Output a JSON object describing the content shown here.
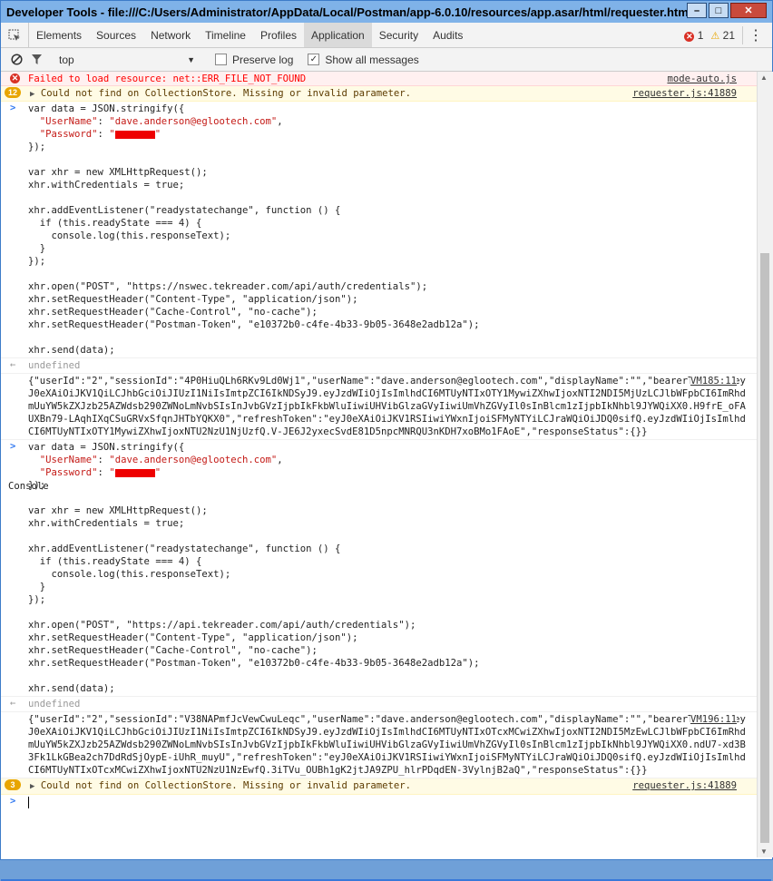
{
  "window": {
    "title": "Developer Tools - file:///C:/Users/Administrator/AppData/Local/Postman/app-6.0.10/resources/app.asar/html/requester.html"
  },
  "tabs": [
    "Elements",
    "Console",
    "Sources",
    "Network",
    "Timeline",
    "Profiles",
    "Application",
    "Security",
    "Audits"
  ],
  "counts": {
    "errors": "1",
    "warnings": "21"
  },
  "toolbar": {
    "context": "top",
    "preserve_log": "Preserve log",
    "show_all": "Show all messages"
  },
  "messages": {
    "m1": {
      "text": "Failed to load resource: net::ERR_FILE_NOT_FOUND",
      "source": "mode-auto.js"
    },
    "m2": {
      "count": "12",
      "text": "Could not find on CollectionStore. Missing or invalid parameter.",
      "source": "requester.js:41889"
    },
    "undefined1": "undefined",
    "log1": {
      "source": "VM185:11",
      "text": "{\"userId\":\"2\",\"sessionId\":\"4P0HiuQLh6RKv9Ld0Wj1\",\"userName\":\"dave.anderson@eglootech.com\",\"displayName\":\"\",\"bearerToken\":\"eyJ0eXAiOiJKV1QiLCJhbGciOiJIUzI1NiIsImtpZCI6IkNDSyJ9.eyJzdWIiOjIsImlhdCI6MTUyNTIxOTY1MywiZXhwIjoxNTI2NDI5MjUzLCJlbWFpbCI6ImRhdmUuYW5kZXJzb25AZWdsb290ZWNoLmNvbSIsInJvbGVzIjpbIkFkbWluIiwiUHVibGlzaGVyIiwiUmVhZGVyIl0sInBlcm1zIjpbIkNhbl9JYWQiXX0.H9frE_oFAUXBn79-LAqhIXqCSuGRVxSfqnJHTbYQKX0\",\"refreshToken\":\"eyJ0eXAiOiJKV1RSIiwiYWxnIjoiSFMyNTYiLCJraWQiOiJDQ0sifQ.eyJzdWIiOjIsImlhdCI6MTUyNTIxOTY1MywiZXhwIjoxNTU2NzU1NjUzfQ.V-JE6J2yxecSvdE81D5npcMNRQU3nKDH7xoBMo1FAoE\",\"responseStatus\":{}}"
    },
    "undefined2": "undefined",
    "log2": {
      "source": "VM196:11",
      "text": "{\"userId\":\"2\",\"sessionId\":\"V38NAPmfJcVewCwuLeqc\",\"userName\":\"dave.anderson@eglootech.com\",\"displayName\":\"\",\"bearerToken\":\"eyJ0eXAiOiJKV1QiLCJhbGciOiJIUzI1NiIsImtpZCI6IkNDSyJ9.eyJzdWIiOjIsImlhdCI6MTUyNTIxOTcxMCwiZXhwIjoxNTI2NDI5MzEwLCJlbWFpbCI6ImRhdmUuYW5kZXJzb25AZWdsb290ZWNoLmNvbSIsInJvbGVzIjpbIkFkbWluIiwiUHVibGlzaGVyIiwiUmVhZGVyIl0sInBlcm1zIjpbIkNhbl9JYWQiXX0.ndU7-xd3B3Fk1LkGBea2ch7DdRdSjOypE-iUhR_muyU\",\"refreshToken\":\"eyJ0eXAiOiJKV1RSIiwiYWxnIjoiSFMyNTYiLCJraWQiOiJDQ0sifQ.eyJzdWIiOjIsImlhdCI6MTUyNTIxOTcxMCwiZXhwIjoxNTU2NzU1NzEwfQ.3iTVu_OUBh1gK2jtJA9ZPU_hlrPDqdEN-3VylnjB2aQ\",\"responseStatus\":{}}"
    },
    "m3": {
      "count": "3",
      "text": "Could not find on CollectionStore. Missing or invalid parameter.",
      "source": "requester.js:41889"
    }
  },
  "code1": {
    "var_line": "var data = JSON.stringify({",
    "user_key": "\"UserName\"",
    "user_val": "\"dave.anderson@eglootech.com\"",
    "pass_key": "\"Password\"",
    "pass_open": "\"",
    "pass_close": "\"",
    "close": "});",
    "xhr_var": "var xhr = new XMLHttpRequest();",
    "creds": "xhr.withCredentials = true;",
    "listen": "xhr.addEventListener(\"readystatechange\", function () {",
    "if": "  if (this.readyState === 4) {",
    "log": "    console.log(this.responseText);",
    "brace": "  }",
    "close2": "});",
    "open": "xhr.open(\"POST\", \"https://nswec.tekreader.com/api/auth/credentials\");",
    "h1": "xhr.setRequestHeader(\"Content-Type\", \"application/json\");",
    "h2": "xhr.setRequestHeader(\"Cache-Control\", \"no-cache\");",
    "h3": "xhr.setRequestHeader(\"Postman-Token\", \"e10372b0-c4fe-4b33-9b05-3648e2adb12a\");",
    "send": "xhr.send(data);"
  },
  "code2": {
    "open": "xhr.open(\"POST\", \"https://api.tekreader.com/api/auth/credentials\");"
  }
}
